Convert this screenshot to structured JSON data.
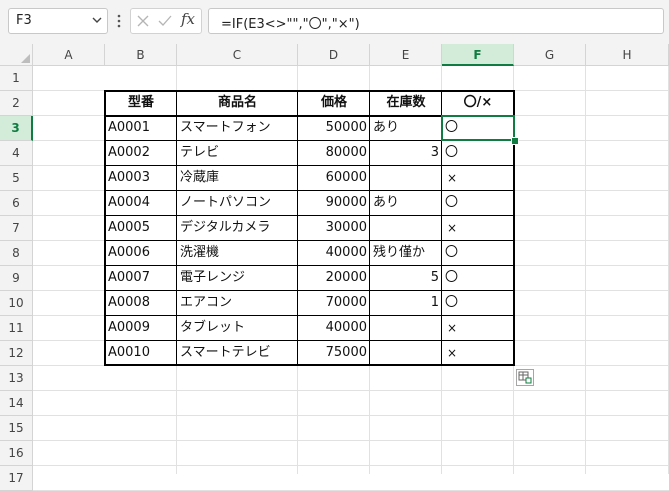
{
  "name_box": {
    "value": "F3"
  },
  "formula_bar": {
    "formula": "=IF(E3<>\"\",\"〇\",\"×\")"
  },
  "columns": [
    "A",
    "B",
    "C",
    "D",
    "E",
    "F",
    "G",
    "H"
  ],
  "rows": [
    "1",
    "2",
    "3",
    "4",
    "5",
    "6",
    "7",
    "8",
    "9",
    "10",
    "11",
    "12",
    "13",
    "14",
    "15",
    "16",
    "17"
  ],
  "table": {
    "headers": [
      "型番",
      "商品名",
      "価格",
      "在庫数",
      "〇/×"
    ],
    "rows": [
      [
        "A0001",
        "スマートフォン",
        "50000",
        "あり",
        "〇"
      ],
      [
        "A0002",
        "テレビ",
        "80000",
        "3",
        "〇"
      ],
      [
        "A0003",
        "冷蔵庫",
        "60000",
        "",
        "×"
      ],
      [
        "A0004",
        "ノートパソコン",
        "90000",
        "あり",
        "〇"
      ],
      [
        "A0005",
        "デジタルカメラ",
        "30000",
        "",
        "×"
      ],
      [
        "A0006",
        "洗濯機",
        "40000",
        "残り僅か",
        "〇"
      ],
      [
        "A0007",
        "電子レンジ",
        "20000",
        "5",
        "〇"
      ],
      [
        "A0008",
        "エアコン",
        "70000",
        "1",
        "〇"
      ],
      [
        "A0009",
        "タブレット",
        "40000",
        "",
        "×"
      ],
      [
        "A0010",
        "スマートテレビ",
        "75000",
        "",
        "×"
      ]
    ]
  },
  "selection": {
    "cell": "F3",
    "accent_color": "#107c41"
  },
  "icons": {
    "name_box_dropdown": "chevron-down-icon",
    "more": "vertical-ellipsis-icon",
    "cancel": "cancel-x-icon",
    "enter": "checkmark-icon",
    "insert_function": "fx-icon",
    "quick_analysis": "quick-analysis-icon"
  }
}
